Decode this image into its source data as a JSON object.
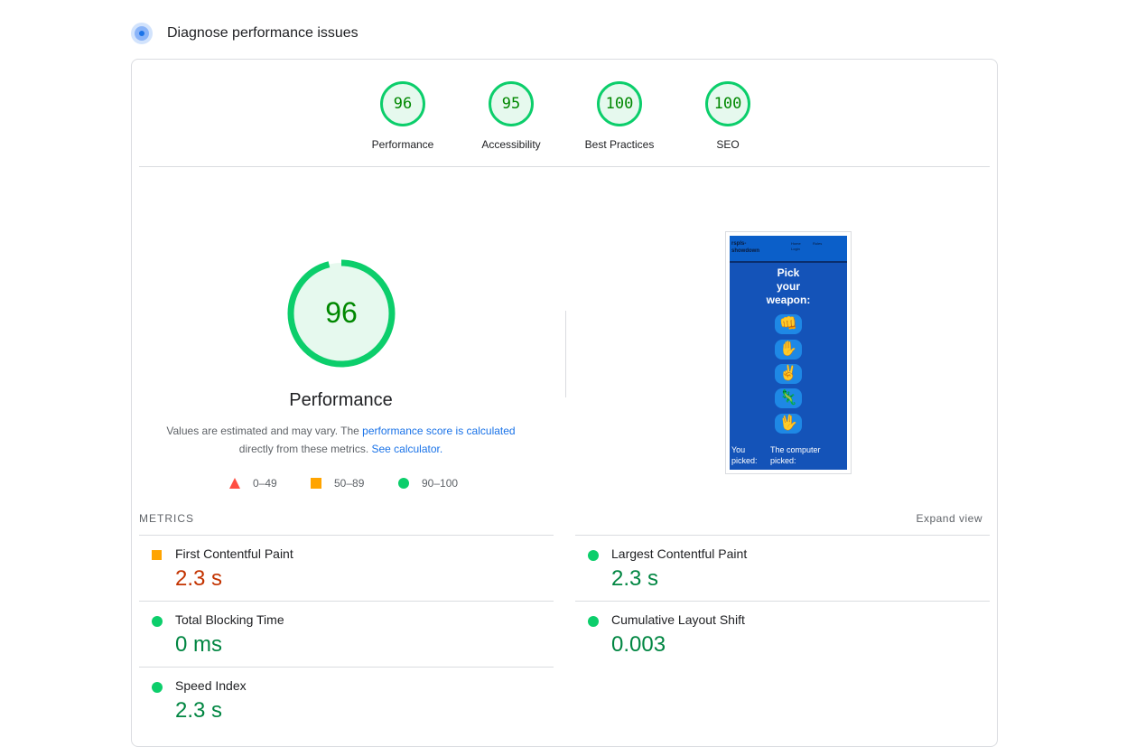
{
  "header": {
    "title": "Diagnose performance issues",
    "icon": "diagnose-icon"
  },
  "categories": [
    {
      "score": "96",
      "label": "Performance"
    },
    {
      "score": "95",
      "label": "Accessibility"
    },
    {
      "score": "100",
      "label": "Best Practices"
    },
    {
      "score": "100",
      "label": "SEO"
    }
  ],
  "performance": {
    "score": "96",
    "score_fraction": 0.96,
    "title": "Performance",
    "note_prefix": "Values are estimated and may vary. The ",
    "note_link1": "performance score is calculated",
    "note_middle": " directly from these metrics. ",
    "note_link2": "See calculator."
  },
  "legend": [
    {
      "shape": "triangle",
      "color": "#ff4e42",
      "range": "0–49"
    },
    {
      "shape": "square",
      "color": "#ffa400",
      "range": "50–89"
    },
    {
      "shape": "circle",
      "color": "#0cce6b",
      "range": "90–100"
    }
  ],
  "screenshot": {
    "brand": "rspls-showdown",
    "nav_links": [
      "Home",
      "Rules",
      "Login"
    ],
    "heading": "Pick your weapon:",
    "weapons": [
      "👊",
      "✋",
      "✌️",
      "🦎",
      "🖖"
    ],
    "you_picked": "You picked:",
    "computer_picked": "The computer picked:"
  },
  "metrics_section": {
    "label": "METRICS",
    "expand": "Expand view"
  },
  "metrics": [
    {
      "name": "First Contentful Paint",
      "value": "2.3 s",
      "rating": "average"
    },
    {
      "name": "Largest Contentful Paint",
      "value": "2.3 s",
      "rating": "good"
    },
    {
      "name": "Total Blocking Time",
      "value": "0 ms",
      "rating": "good"
    },
    {
      "name": "Cumulative Layout Shift",
      "value": "0.003",
      "rating": "good"
    },
    {
      "name": "Speed Index",
      "value": "2.3 s",
      "rating": "good"
    }
  ],
  "colors": {
    "good": "#0cce6b",
    "average": "#ffa400",
    "poor": "#ff4e42",
    "link": "#1a73e8"
  }
}
